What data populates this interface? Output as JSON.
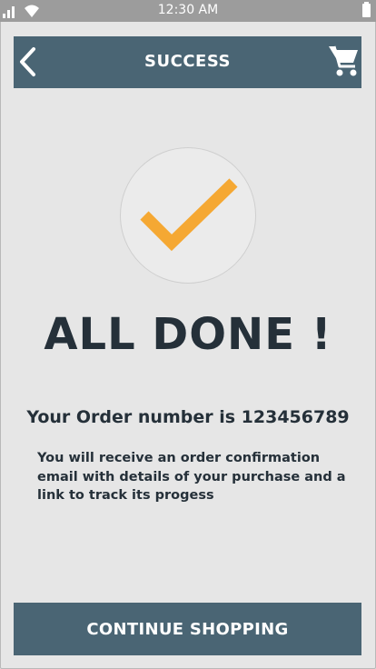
{
  "status_bar": {
    "time": "12:30 AM",
    "icons": [
      "signal-icon",
      "wifi-icon",
      "battery-icon"
    ]
  },
  "header": {
    "title": "SUCCESS",
    "back_icon": "chevron-left-icon",
    "cart_icon": "cart-icon"
  },
  "main": {
    "success_icon": "checkmark-icon",
    "headline": "ALL DONE !",
    "order_text": "Your Order number is 123456789",
    "message": "You will receive an order confirmation email with details of your purchase and a link to track its progess"
  },
  "footer": {
    "continue_label": "CONTINUE SHOPPING"
  },
  "colors": {
    "background": "#e6e6e6",
    "status_bar": "#9c9c9c",
    "primary": "#4a6574",
    "text_dark": "#253039",
    "accent": "#f5a833"
  }
}
